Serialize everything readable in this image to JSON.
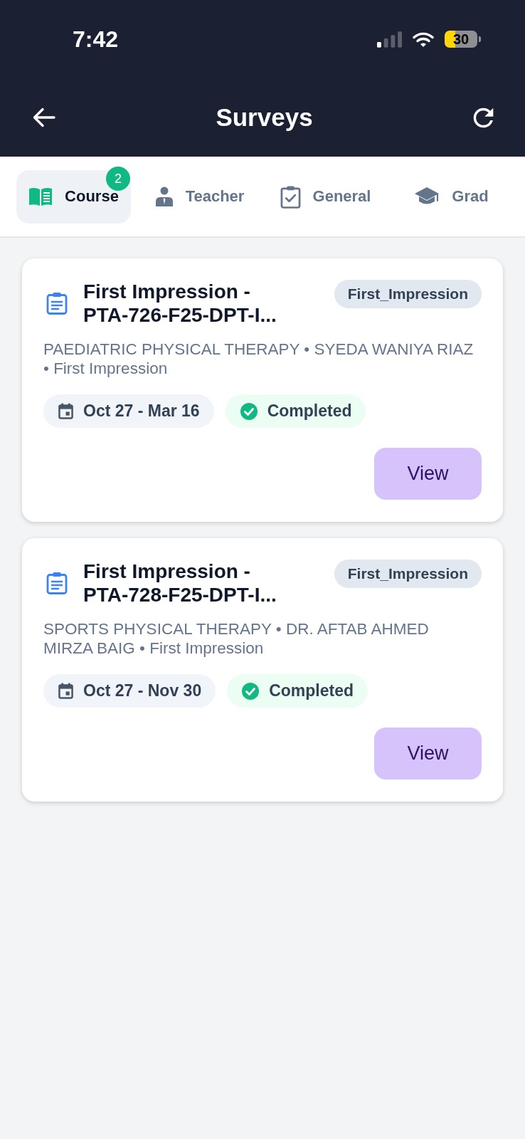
{
  "status_bar": {
    "time": "7:42",
    "battery": "30"
  },
  "header": {
    "title": "Surveys"
  },
  "tabs": [
    {
      "label": "Course",
      "selected": true,
      "badge": "2"
    },
    {
      "label": "Teacher",
      "selected": false
    },
    {
      "label": "General",
      "selected": false
    },
    {
      "label": "Grad",
      "selected": false
    }
  ],
  "surveys": [
    {
      "title": "First Impression - PTA-726-F25-DPT-I...",
      "tag": "First_Impression",
      "details": "PAEDIATRIC PHYSICAL THERAPY • SYEDA WANIYA RIAZ • First Impression",
      "dates": "Oct 27 - Mar 16",
      "status": "Completed",
      "completed": true,
      "action": "View"
    },
    {
      "title": "First Impression - PTA-728-F25-DPT-I...",
      "tag": "First_Impression",
      "details": "SPORTS PHYSICAL THERAPY • DR. AFTAB AHMED MIRZA BAIG • First Impression",
      "dates": "Oct 27 - Nov 30",
      "status": "Completed",
      "completed": true,
      "action": "View"
    }
  ]
}
